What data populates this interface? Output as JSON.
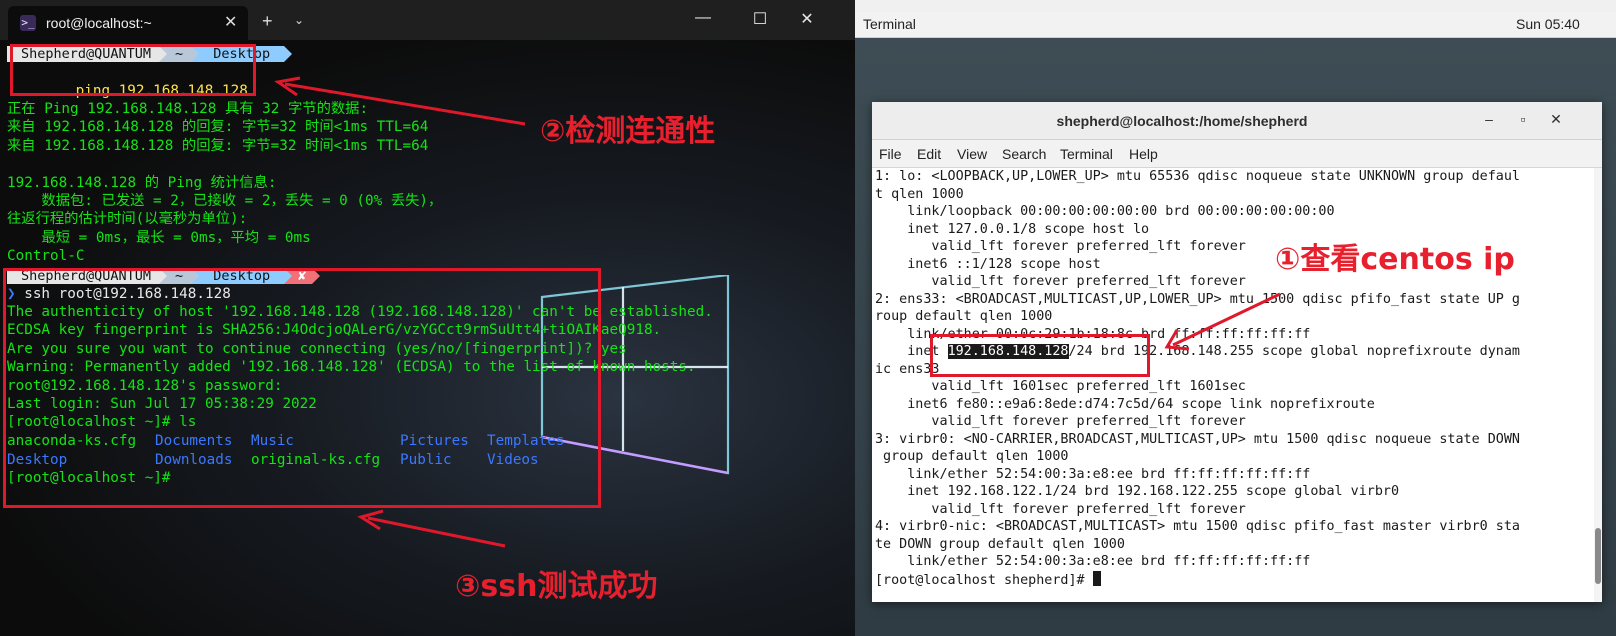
{
  "left_terminal": {
    "tab_title": "root@localhost:~",
    "tab_icon": "powershell-icon",
    "new_tab": "+",
    "prompt1": {
      "user": "Shepherd@QUANTUM",
      "home": "~",
      "dir": "Desktop"
    },
    "cmd_ping": "ping 192.168.148.128",
    "ping_output": [
      "正在 Ping 192.168.148.128 具有 32 字节的数据:",
      "来自 192.168.148.128 的回复: 字节=32 时间<1ms TTL=64",
      "来自 192.168.148.128 的回复: 字节=32 时间<1ms TTL=64",
      "",
      "192.168.148.128 的 Ping 统计信息:",
      "    数据包: 已发送 = 2，已接收 = 2，丢失 = 0 (0% 丢失)，",
      "往返行程的估计时间(以毫秒为单位):",
      "    最短 = 0ms，最长 = 0ms，平均 = 0ms",
      "Control-C"
    ],
    "prompt2": {
      "user": "Shepherd@QUANTUM",
      "home": "~",
      "dir": "Desktop",
      "status": "✘"
    },
    "cmd_ssh": "ssh root@192.168.148.128",
    "ssh_output": [
      "The authenticity of host '192.168.148.128 (192.168.148.128)' can't be established.",
      "ECDSA key fingerprint is SHA256:J4OdcjoQALerG/vzYGCct9rmSuUtt4+tiOAIKaeQ918.",
      "Are you sure you want to continue connecting (yes/no/[fingerprint])? yes",
      "Warning: Permanently added '192.168.148.128' (ECDSA) to the list of known hosts.",
      "root@192.168.148.128's password:",
      "Last login: Sun Jul 17 05:38:29 2022",
      "[root@localhost ~]# ls"
    ],
    "ls_row1": [
      {
        "name": "anaconda-ks.cfg",
        "color": "#15e315"
      },
      {
        "name": "Documents",
        "color": "#3b78ff"
      },
      {
        "name": "Music",
        "color": "#3b78ff"
      },
      {
        "name": "Pictures",
        "color": "#3b78ff"
      },
      {
        "name": "Templates",
        "color": "#3b78ff"
      }
    ],
    "ls_row2": [
      {
        "name": "Desktop",
        "color": "#3b78ff"
      },
      {
        "name": "Downloads",
        "color": "#3b78ff"
      },
      {
        "name": "original-ks.cfg",
        "color": "#15e315"
      },
      {
        "name": "Public",
        "color": "#3b78ff"
      },
      {
        "name": "Videos",
        "color": "#3b78ff"
      }
    ],
    "final_prompt": "[root@localhost ~]#"
  },
  "annotations": {
    "step2": "②检测连通性",
    "step3": "③ssh测试成功",
    "step1": "①查看centos ip",
    "color": "#e0182b"
  },
  "vm": {
    "topbar_app": "Terminal",
    "clock": "Sun 05:40",
    "window_title": "shepherd@localhost:/home/shepherd",
    "menu": [
      "File",
      "Edit",
      "View",
      "Search",
      "Terminal",
      "Help"
    ],
    "lines": [
      "1: lo: <LOOPBACK,UP,LOWER_UP> mtu 65536 qdisc noqueue state UNKNOWN group defaul",
      "t qlen 1000",
      "    link/loopback 00:00:00:00:00:00 brd 00:00:00:00:00:00",
      "    inet 127.0.0.1/8 scope host lo",
      "       valid_lft forever preferred_lft forever",
      "    inet6 ::1/128 scope host",
      "       valid_lft forever preferred_lft forever",
      "2: ens33: <BROADCAST,MULTICAST,UP,LOWER_UP> mtu 1500 qdisc pfifo_fast state UP g",
      "roup default qlen 1000",
      "    link/ether 00:0c:29:1b:18:8c brd ff:ff:ff:ff:ff:ff"
    ],
    "inet_prefix": "    inet ",
    "inet_ip": "192.168.148.128",
    "inet_suffix": "/24 brd 192.168.148.255 scope global noprefixroute dynam",
    "lines2": [
      "ic ens33",
      "       valid_lft 1601sec preferred_lft 1601sec",
      "    inet6 fe80::e9a6:8ede:d74:7c5d/64 scope link noprefixroute",
      "       valid_lft forever preferred_lft forever",
      "3: virbr0: <NO-CARRIER,BROADCAST,MULTICAST,UP> mtu 1500 qdisc noqueue state DOWN",
      " group default qlen 1000",
      "    link/ether 52:54:00:3a:e8:ee brd ff:ff:ff:ff:ff:ff",
      "    inet 192.168.122.1/24 brd 192.168.122.255 scope global virbr0",
      "       valid_lft forever preferred_lft forever",
      "4: virbr0-nic: <BROADCAST,MULTICAST> mtu 1500 qdisc pfifo_fast master virbr0 sta",
      "te DOWN group default qlen 1000",
      "    link/ether 52:54:00:3a:e8:ee brd ff:ff:ff:ff:ff:ff"
    ],
    "final_prompt": "[root@localhost shepherd]# "
  }
}
